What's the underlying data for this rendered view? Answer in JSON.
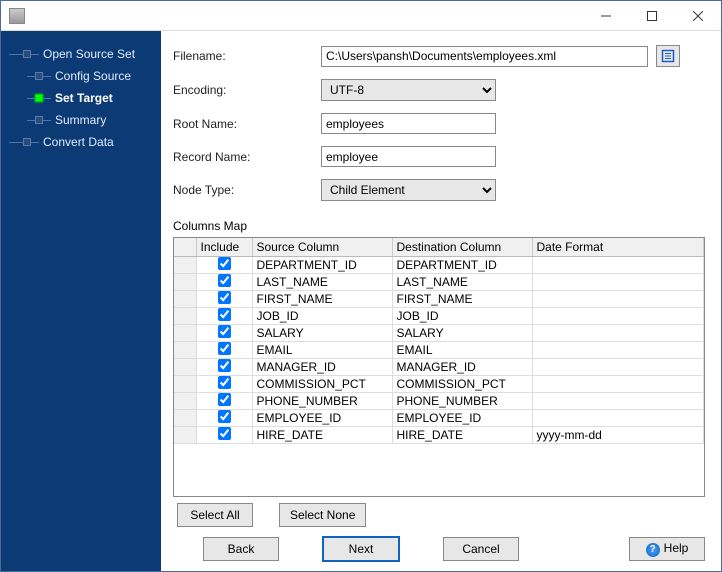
{
  "titlebar": {
    "min_tooltip": "Minimize",
    "max_tooltip": "Maximize",
    "close_tooltip": "Close"
  },
  "sidebar": {
    "items": [
      {
        "label": "Open Source Set",
        "indent": false,
        "active": false,
        "bold": false
      },
      {
        "label": "Config Source",
        "indent": true,
        "active": false,
        "bold": false
      },
      {
        "label": "Set Target",
        "indent": true,
        "active": true,
        "bold": true
      },
      {
        "label": "Summary",
        "indent": true,
        "active": false,
        "bold": false
      },
      {
        "label": "Convert Data",
        "indent": false,
        "active": false,
        "bold": false
      }
    ]
  },
  "form": {
    "filename_label": "Filename:",
    "filename_value": "C:\\Users\\pansh\\Documents\\employees.xml",
    "browse_icon": "folder-icon",
    "encoding_label": "Encoding:",
    "encoding_value": "UTF-8",
    "rootname_label": "Root Name:",
    "rootname_value": "employees",
    "recordname_label": "Record Name:",
    "recordname_value": "employee",
    "nodetype_label": "Node Type:",
    "nodetype_value": "Child Element"
  },
  "columns": {
    "section_label": "Columns Map",
    "headers": {
      "include": "Include",
      "source": "Source Column",
      "destination": "Destination Column",
      "format": "Date Format"
    },
    "rows": [
      {
        "include": true,
        "source": "DEPARTMENT_ID",
        "destination": "DEPARTMENT_ID",
        "format": ""
      },
      {
        "include": true,
        "source": "LAST_NAME",
        "destination": "LAST_NAME",
        "format": ""
      },
      {
        "include": true,
        "source": "FIRST_NAME",
        "destination": "FIRST_NAME",
        "format": ""
      },
      {
        "include": true,
        "source": "JOB_ID",
        "destination": "JOB_ID",
        "format": ""
      },
      {
        "include": true,
        "source": "SALARY",
        "destination": "SALARY",
        "format": ""
      },
      {
        "include": true,
        "source": "EMAIL",
        "destination": "EMAIL",
        "format": ""
      },
      {
        "include": true,
        "source": "MANAGER_ID",
        "destination": "MANAGER_ID",
        "format": ""
      },
      {
        "include": true,
        "source": "COMMISSION_PCT",
        "destination": "COMMISSION_PCT",
        "format": ""
      },
      {
        "include": true,
        "source": "PHONE_NUMBER",
        "destination": "PHONE_NUMBER",
        "format": ""
      },
      {
        "include": true,
        "source": "EMPLOYEE_ID",
        "destination": "EMPLOYEE_ID",
        "format": ""
      },
      {
        "include": true,
        "source": "HIRE_DATE",
        "destination": "HIRE_DATE",
        "format": "yyyy-mm-dd"
      }
    ]
  },
  "buttons": {
    "select_all": "Select All",
    "select_none": "Select None",
    "back": "Back",
    "next": "Next",
    "cancel": "Cancel",
    "help": "Help"
  }
}
